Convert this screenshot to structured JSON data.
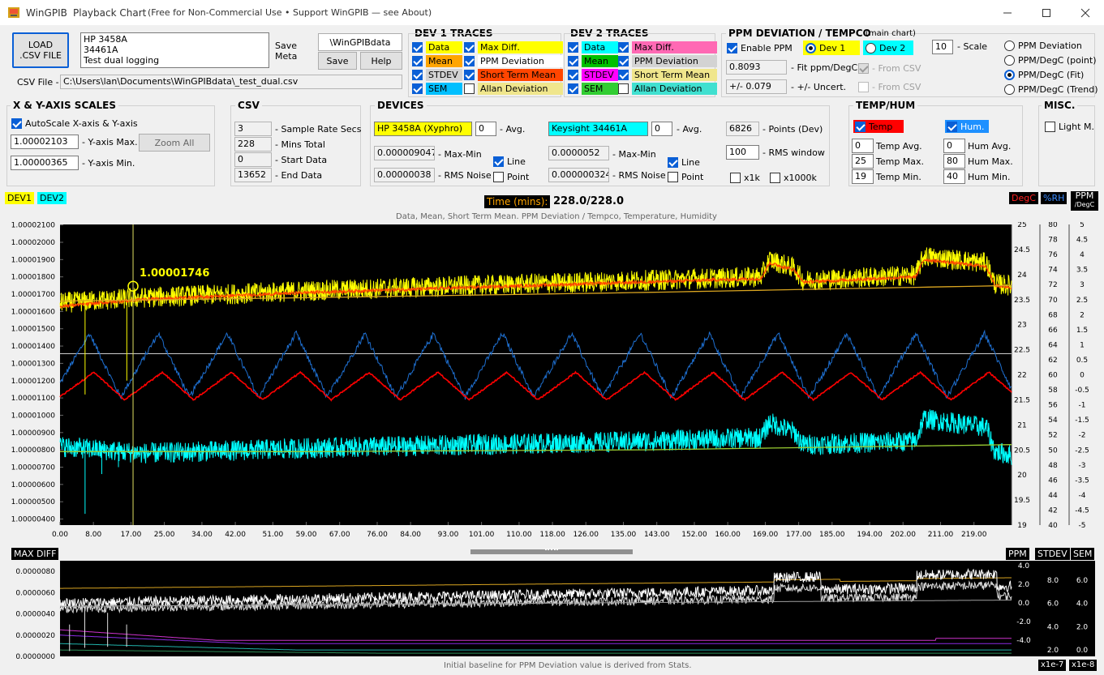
{
  "window": {
    "app_name": "WinGPIB",
    "title": "Playback Chart",
    "subtitle": "(Free for Non-Commercial Use • Support WinGPIB — see About)"
  },
  "toolbar": {
    "load_csv_label": "LOAD .CSV FILE",
    "meta_text": [
      "HP 3458A",
      "34461A",
      "Test dual logging"
    ],
    "save_meta_label": "Save Meta",
    "folder_label": "\\WinGPIBdata",
    "save_label": "Save",
    "help_label": "Help",
    "csv_file_label": "CSV File -",
    "csv_file_path": "C:\\Users\\lan\\Documents\\WinGPIBdata\\_test_dual.csv"
  },
  "dev1_traces": {
    "title": "DEV 1 TRACES",
    "items": [
      {
        "label": "Data",
        "checked": true,
        "bg": "#ffff00"
      },
      {
        "label": "Max Diff.",
        "checked": true,
        "bg": "#ffff00"
      },
      {
        "label": "Mean",
        "checked": true,
        "bg": "#ffa500"
      },
      {
        "label": "PPM Deviation",
        "checked": true,
        "bg": "#ffffff"
      },
      {
        "label": "STDEV",
        "checked": true,
        "bg": "#d3d3d3"
      },
      {
        "label": "Short Term Mean",
        "checked": true,
        "bg": "#ff4500"
      },
      {
        "label": "SEM",
        "checked": true,
        "bg": "#00bfff"
      },
      {
        "label": "Allan Deviation",
        "checked": false,
        "bg": "#f0e68c"
      }
    ]
  },
  "dev2_traces": {
    "title": "DEV 2 TRACES",
    "items": [
      {
        "label": "Data",
        "checked": true,
        "bg": "#00ffff"
      },
      {
        "label": "Max Diff.",
        "checked": true,
        "bg": "#ff69b4"
      },
      {
        "label": "Mean",
        "checked": true,
        "bg": "#00c000"
      },
      {
        "label": "PPM Deviation",
        "checked": true,
        "bg": "#d3d3d3"
      },
      {
        "label": "STDEV",
        "checked": true,
        "bg": "#ff00ff"
      },
      {
        "label": "Short Term Mean",
        "checked": true,
        "bg": "#f0e68c"
      },
      {
        "label": "SEM",
        "checked": true,
        "bg": "#32cd32"
      },
      {
        "label": "Allan Deviation",
        "checked": false,
        "bg": "#40e0d0"
      }
    ]
  },
  "ppm": {
    "title": "PPM DEVIATION / TEMPCO",
    "title_note": "(main chart)",
    "enable_label": "Enable PPM",
    "enable_checked": true,
    "dev1_label": "Dev 1",
    "dev2_label": "Dev 2",
    "scale_value": "10",
    "scale_label": "- Scale",
    "fit_value": "0.8093",
    "fit_label": "- Fit ppm/DegC",
    "uncert_value": "+/- 0.079",
    "uncert_label": "- +/- Uncert.",
    "from_csv_1": "- From CSV",
    "from_csv_2": "- From CSV",
    "modes": [
      "PPM Deviation",
      "PPM/DegC (point)",
      "PPM/DegC (Fit)",
      "PPM/DegC (Trend)"
    ],
    "selected_mode": 2
  },
  "xy_scales": {
    "title": "X & Y-AXIS SCALES",
    "autoscale_label": "AutoScale X-axis & Y-axis",
    "autoscale_checked": true,
    "ymax_value": "1.00002103",
    "ymax_label": "- Y-axis Max.",
    "ymin_value": "1.00000365",
    "ymin_label": "- Y-axis Min.",
    "zoom_all_label": "Zoom All"
  },
  "csv": {
    "title": "CSV",
    "rows": [
      {
        "value": "3",
        "label": "- Sample Rate Secs"
      },
      {
        "value": "228",
        "label": "- Mins Total"
      },
      {
        "value": "0",
        "label": "- Start Data"
      },
      {
        "value": "13652",
        "label": "- End Data"
      }
    ]
  },
  "devices": {
    "title": "DEVICES",
    "dev1_name": "HP 3458A (Xyphro)",
    "dev1_avg": "0",
    "dev2_name": "Keysight 34461A",
    "dev2_avg": "0",
    "avg_label": "- Avg.",
    "dev1_maxmin": "0.000009047",
    "dev2_maxmin": "0.0000052",
    "maxmin_label": "- Max-Min",
    "dev1_rms": "0.00000038",
    "dev2_rms": "0.000000324",
    "rms_label": "- RMS Noise",
    "line_label": "Line",
    "point_label": "Point",
    "points_value": "6826",
    "points_label": "- Points (Dev)",
    "rms_window_value": "100",
    "rms_window_label": "- RMS window",
    "x1k_label": "x1k",
    "x1000k_label": "x1000k"
  },
  "temphum": {
    "title": "TEMP/HUM",
    "temp_label": "Temp",
    "hum_label": "Hum.",
    "temp_color": "#ff0000",
    "hum_color": "#1e90ff",
    "rows": [
      {
        "t": "0",
        "tl": "Temp Avg.",
        "h": "0",
        "hl": "Hum Avg."
      },
      {
        "t": "25",
        "tl": "Temp Max.",
        "h": "80",
        "hl": "Hum Max."
      },
      {
        "t": "19",
        "tl": "Temp Min.",
        "h": "40",
        "hl": "Hum Min."
      }
    ]
  },
  "misc": {
    "title": "MISC.",
    "light_label": "Light M."
  },
  "chart_header": {
    "dev1_tag": "DEV1",
    "dev2_tag": "DEV2",
    "time_label": "Time (mins):",
    "time_value": "228.0/228.0",
    "degc_tag": "DegC",
    "rh_tag": "%RH",
    "ppm_tag": "PPM",
    "ppm_sub": "/DegC",
    "subtitle": "Data, Mean, Short Term Mean. PPM Deviation / Tempco, Temperature, Humidity",
    "cursor_value": "1.00001746"
  },
  "chart_data": [
    {
      "type": "line",
      "x_ticks": [
        "0.00",
        "8.00",
        "17.00",
        "25.00",
        "34.00",
        "42.00",
        "51.00",
        "59.00",
        "67.00",
        "76.00",
        "84.00",
        "93.00",
        "101.00",
        "110.00",
        "118.00",
        "126.00",
        "135.00",
        "143.00",
        "152.00",
        "160.00",
        "169.00",
        "177.00",
        "185.00",
        "194.00",
        "202.00",
        "211.00",
        "219.00"
      ],
      "y_ticks": [
        "1.00002100",
        "1.00002000",
        "1.00001900",
        "1.00001800",
        "1.00001700",
        "1.00001600",
        "1.00001500",
        "1.00001400",
        "1.00001300",
        "1.00001200",
        "1.00001100",
        "1.00001000",
        "1.00000900",
        "1.00000800",
        "1.00000700",
        "1.00000600",
        "1.00000500",
        "1.00000400"
      ],
      "degc_ticks": [
        "25",
        "24.5",
        "24",
        "23.5",
        "23",
        "22.5",
        "22",
        "21.5",
        "21",
        "20.5",
        "20",
        "19.5",
        "19"
      ],
      "rh_ticks": [
        "80",
        "78",
        "76",
        "74",
        "72",
        "70",
        "68",
        "66",
        "64",
        "62",
        "60",
        "58",
        "56",
        "54",
        "52",
        "50",
        "48",
        "46",
        "44",
        "42",
        "40"
      ],
      "ppm_ticks": [
        "5",
        "4.5",
        "4",
        "3.5",
        "3",
        "2.5",
        "2",
        "1.5",
        "1",
        "0.5",
        "0",
        "-0.5",
        "-1",
        "-1.5",
        "-2",
        "-2.5",
        "-3",
        "-3.5",
        "-4",
        "-4.5",
        "-5"
      ],
      "xlim": [
        0,
        228
      ],
      "ylim": [
        1.00000365,
        1.00002103
      ],
      "cursor": {
        "x": 17.5,
        "y": 1.00001746
      },
      "series": [
        {
          "color": "#ffff00",
          "knots": [
            [
              0,
              1.0000165
            ],
            [
              20,
              1.0000168
            ],
            [
              60,
              1.0000172
            ],
            [
              100,
              1.0000175
            ],
            [
              140,
              1.0000178
            ],
            [
              168,
              1.000018
            ],
            [
              170,
              1.000019
            ],
            [
              176,
              1.0000185
            ],
            [
              178,
              1.0000178
            ],
            [
              205,
              1.0000181
            ],
            [
              207,
              1.0000192
            ],
            [
              222,
              1.0000188
            ],
            [
              224,
              1.0000176
            ],
            [
              228,
              1.0000175
            ]
          ],
          "noise": 6e-07
        },
        {
          "color": "#ff4500",
          "knots": [
            [
              0,
              1.0000163
            ],
            [
              20,
              1.0000167
            ],
            [
              60,
              1.0000171
            ],
            [
              100,
              1.0000174
            ],
            [
              140,
              1.0000177
            ],
            [
              168,
              1.0000179
            ],
            [
              170,
              1.0000188
            ],
            [
              176,
              1.0000184
            ],
            [
              178,
              1.0000177
            ],
            [
              205,
              1.000018
            ],
            [
              207,
              1.000019
            ],
            [
              222,
              1.0000186
            ],
            [
              224,
              1.0000175
            ],
            [
              228,
              1.0000174
            ]
          ],
          "noise": 1e-07
        },
        {
          "color": "#00ffff",
          "knots": [
            [
              0,
              1.0000082
            ],
            [
              20,
              1.0000078
            ],
            [
              60,
              1.0000081
            ],
            [
              100,
              1.0000083
            ],
            [
              140,
              1.0000085
            ],
            [
              168,
              1.0000087
            ],
            [
              170,
              1.0000096
            ],
            [
              176,
              1.000009
            ],
            [
              178,
              1.0000083
            ],
            [
              205,
              1.0000085
            ],
            [
              207,
              1.0000098
            ],
            [
              222,
              1.0000093
            ],
            [
              224,
              1.0000079
            ],
            [
              228,
              1.0000077
            ]
          ],
          "noise": 6e-07
        },
        {
          "color": "#9acd32",
          "knots": [
            [
              0,
              1.0000079
            ],
            [
              60,
              1.0000079
            ],
            [
              140,
              1.000008
            ],
            [
              228,
              1.0000083
            ]
          ],
          "noise": 0
        },
        {
          "color": "#daa520",
          "knots": [
            [
              0,
              1.0000166
            ],
            [
              60,
              1.0000168
            ],
            [
              140,
              1.0000171
            ],
            [
              228,
              1.0000175
            ]
          ],
          "noise": 0
        }
      ],
      "temperature": {
        "color": "#ff0000",
        "cycle_period": 16.5,
        "min": 21.5,
        "max": 22.05,
        "start_peak": 0
      },
      "humidity": {
        "color": "#1e6fd0",
        "cycle_period": 16.5,
        "min": 57,
        "max": 65.5
      },
      "ppm_baseline": {
        "color": "#cccccc",
        "value": 0.7
      }
    },
    {
      "type": "line",
      "title": "MAX DIFF",
      "y_ticks": [
        "0.0000080",
        "0.0000060",
        "0.0000040",
        "0.0000020",
        "0.0000000"
      ],
      "ppm_ticks": [
        "4.0",
        "2.0",
        "0.0",
        "-2.0",
        "-4.0"
      ],
      "stdev_ticks": [
        "8.0",
        "6.0",
        "4.0",
        "2.0"
      ],
      "sem_ticks": [
        "6.0",
        "4.0",
        "2.0",
        "0.0"
      ],
      "ylim": [
        0,
        9e-06
      ],
      "scale_tags": [
        "PPM",
        "STDEV",
        "SEM"
      ],
      "multiplier_tags": [
        "x1e-7",
        "x1e-8"
      ],
      "note": "Initial baseline for PPM Deviation value is derived from Stats."
    }
  ]
}
